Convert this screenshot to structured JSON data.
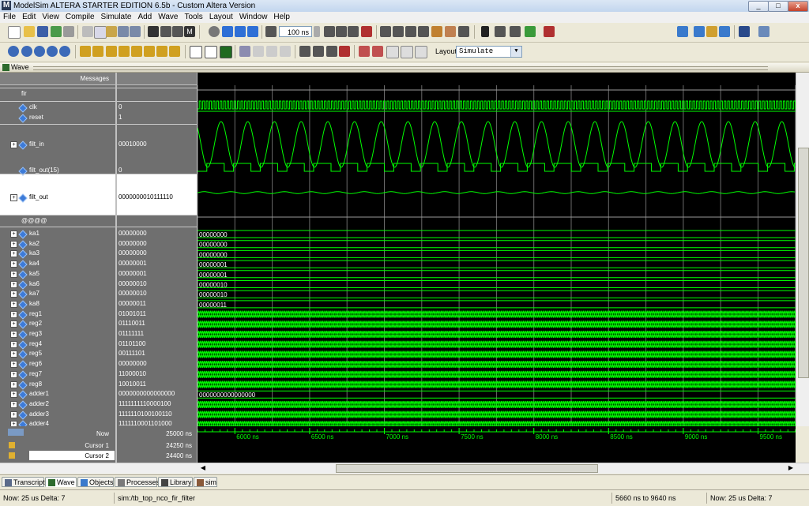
{
  "window": {
    "title": "ModelSim ALTERA STARTER EDITION 6.5b - Custom Altera Version"
  },
  "menu": [
    "File",
    "Edit",
    "View",
    "Compile",
    "Simulate",
    "Add",
    "Wave",
    "Tools",
    "Layout",
    "Window",
    "Help"
  ],
  "toolbar": {
    "zoom_value": "100 ns",
    "layout_label": "Layout",
    "layout_value": "Simulate"
  },
  "wave_window": {
    "title": "Wave",
    "messages_header": "Messages"
  },
  "groups": {
    "top": "fir",
    "second": "@@@@"
  },
  "signals": [
    {
      "name": "clk",
      "value": "0"
    },
    {
      "name": "reset",
      "value": "1"
    },
    {
      "name": "filt_in",
      "value": "00010000"
    },
    {
      "name": "filt_out(15)",
      "value": "0"
    },
    {
      "name": "filt_out",
      "value": "0000000010111110"
    },
    {
      "name": "ka1",
      "value": "00000000"
    },
    {
      "name": "ka2",
      "value": "00000000"
    },
    {
      "name": "ka3",
      "value": "00000000"
    },
    {
      "name": "ka4",
      "value": "00000001"
    },
    {
      "name": "ka5",
      "value": "00000001"
    },
    {
      "name": "ka6",
      "value": "00000010"
    },
    {
      "name": "ka7",
      "value": "00000010"
    },
    {
      "name": "ka8",
      "value": "00000011"
    },
    {
      "name": "reg1",
      "value": "01001011"
    },
    {
      "name": "reg2",
      "value": "01110011"
    },
    {
      "name": "reg3",
      "value": "01111111"
    },
    {
      "name": "reg4",
      "value": "01101100"
    },
    {
      "name": "reg5",
      "value": "00111101"
    },
    {
      "name": "reg6",
      "value": "00000000"
    },
    {
      "name": "reg7",
      "value": "11000010"
    },
    {
      "name": "reg8",
      "value": "10010011"
    },
    {
      "name": "adder1",
      "value": "0000000000000000"
    },
    {
      "name": "adder2",
      "value": "1111111110000100"
    },
    {
      "name": "adder3",
      "value": "1111110100100110"
    },
    {
      "name": "adder4",
      "value": "1111110001101000"
    }
  ],
  "wave_labels": {
    "ka1": "00000000",
    "ka2": "00000000",
    "ka3": "00000000",
    "ka4": "00000001",
    "ka5": "00000001",
    "ka6": "00000010",
    "ka7": "00000010",
    "ka8": "00000011",
    "adder1": "0000000000000000"
  },
  "cursors": {
    "now_label": "Now",
    "now_value": "25000 ns",
    "cursor1_label": "Cursor 1",
    "cursor1_value": "24250 ns",
    "cursor2_label": "Cursor 2",
    "cursor2_value": "24400 ns"
  },
  "timeline": {
    "ticks": [
      "6000 ns",
      "6500 ns",
      "7000 ns",
      "7500 ns",
      "8000 ns",
      "8500 ns",
      "9000 ns",
      "9500 ns"
    ]
  },
  "tabs": [
    "Transcript",
    "Wave",
    "Objects",
    "Processes",
    "Library",
    "sim"
  ],
  "status": {
    "now_delta_left": "Now: 25 us  Delta: 7",
    "context": "sim:/tb_top_nco_fir_filter",
    "range": "5660 ns to 9640 ns",
    "now_delta_right": "Now: 25 us  Delta: 7"
  },
  "colors": {
    "wave_green": "#00ff00",
    "wave_bg": "#000000",
    "pane_bg": "#6f6f6f"
  }
}
